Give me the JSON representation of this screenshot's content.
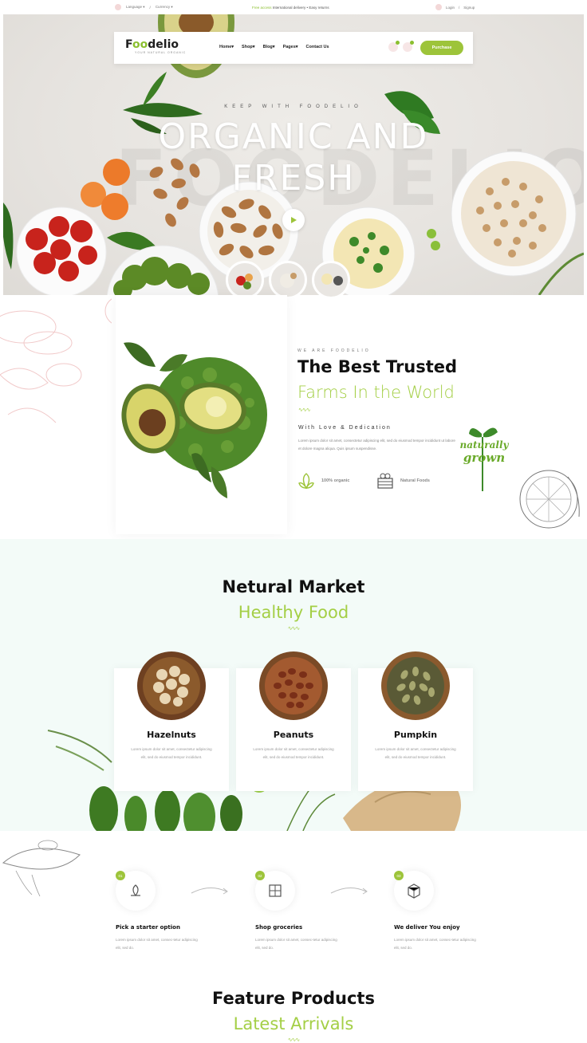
{
  "colors": {
    "accent": "#9dc43a",
    "accent_light": "#a4cf46",
    "market_bg": "#f3fbf8"
  },
  "topbar": {
    "language": "Language",
    "currency": "Currency",
    "sep": "/",
    "promo_highlight": "Free access",
    "promo_text": "International delivery • Easy returns",
    "login": "Login",
    "signup": "Signup"
  },
  "nav": {
    "logo_prefix": "F",
    "logo_oo": "oo",
    "logo_suffix": "delio",
    "logo_tag": "YOUR NATURAL ORGANIC",
    "menu": [
      "Home",
      "Shop",
      "Blog",
      "Pages",
      "Contact Us"
    ],
    "purchase_label": "Purchase",
    "icons": [
      "user-icon",
      "cart-icon"
    ]
  },
  "hero": {
    "eyebrow": "KEEP WITH FOODELIO",
    "title_line1": "ORGANIC AND",
    "title_line2": "FRESH",
    "bg_word": "FOODELIO"
  },
  "about": {
    "eyebrow": "WE ARE FOODELIO",
    "title": "The Best Trusted",
    "subtitle": "Farms In the World",
    "wave": "∿∿∿",
    "tagline": "With Love & Dedication",
    "paragraph": "Lorem ipsum dolor sit amet, consectetur adipiscing elit, sed do eiusmod tempor incididunt ut labore et dolore magna aliqua. Quis ipsum suspendisse.",
    "features": [
      {
        "icon": "leaf-icon",
        "label": "100% organic"
      },
      {
        "icon": "basket-icon",
        "label": "Natural Foods"
      }
    ],
    "badge_line1": "naturally",
    "badge_line2": "grown"
  },
  "market": {
    "title": "Netural Market",
    "subtitle": "Healthy Food",
    "wave": "∿∿∿",
    "products": [
      {
        "name": "Hazelnuts",
        "desc": "Lorem ipsum dolor sit amet, consectetur adipiscing elit, sed do eiusmod tempor incididunt."
      },
      {
        "name": "Peanuts",
        "desc": "Lorem ipsum dolor sit amet, consectetur adipiscing elit, sed do eiusmod tempor incididunt."
      },
      {
        "name": "Pumpkin",
        "desc": "Lorem ipsum dolor sit amet, consectetur adipiscing elit, sed do eiusmod tempor incididunt."
      }
    ]
  },
  "steps": [
    {
      "num": "01",
      "title": "Pick a starter option",
      "desc": "Lorem ipsum dolor sit amet, consec-tetur adipiscing elit, sed do."
    },
    {
      "num": "02",
      "title": "Shop groceries",
      "desc": "Lorem ipsum dolor sit amet, consec-tetur adipiscing elit, sed do."
    },
    {
      "num": "03",
      "title": "We deliver You enjoy",
      "desc": "Lorem ipsum dolor sit amet, consec-tetur adipiscing elit, sed do."
    }
  ],
  "featured": {
    "title": "Feature Products",
    "subtitle": "Latest Arrivals",
    "wave": "∿∿∿"
  }
}
